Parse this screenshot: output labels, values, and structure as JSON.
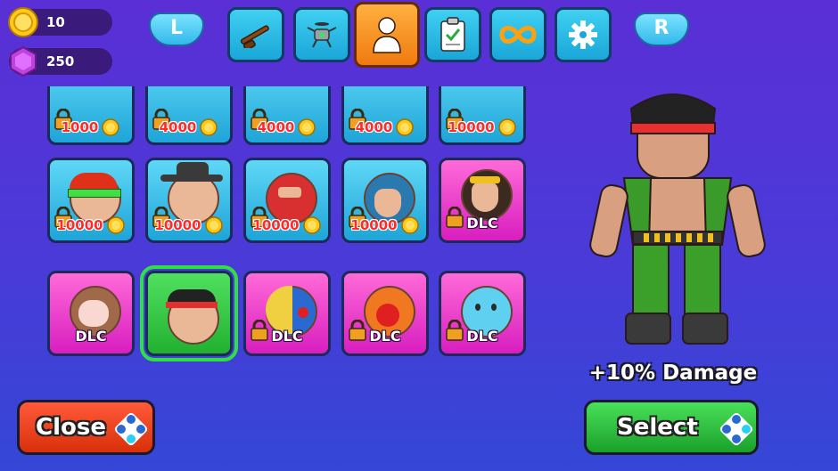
{
  "currency": {
    "coins": "10",
    "gems": "250"
  },
  "nav": {
    "left_shoulder": "L",
    "right_shoulder": "R",
    "tabs": [
      {
        "icon": "rifle-icon",
        "active": false
      },
      {
        "icon": "drone-icon",
        "active": false
      },
      {
        "icon": "person-icon",
        "active": true
      },
      {
        "icon": "clipboard-check-icon",
        "active": false
      },
      {
        "icon": "infinity-icon",
        "active": false
      },
      {
        "icon": "gear-icon",
        "active": false
      }
    ]
  },
  "grid": {
    "row_top": [
      {
        "price": "1000",
        "locked": true
      },
      {
        "price": "4000",
        "locked": true
      },
      {
        "price": "4000",
        "locked": true
      },
      {
        "price": "4000",
        "locked": true
      },
      {
        "price": "10000",
        "locked": true
      }
    ],
    "row_middle": [
      {
        "price": "10000",
        "locked": true,
        "style": "blue"
      },
      {
        "price": "10000",
        "locked": true,
        "style": "blue"
      },
      {
        "price": "10000",
        "locked": true,
        "style": "blue"
      },
      {
        "price": "10000",
        "locked": true,
        "style": "blue"
      },
      {
        "label": "DLC",
        "locked": true,
        "style": "pink"
      }
    ],
    "row_bottom": [
      {
        "label": "DLC",
        "locked": false,
        "style": "pink"
      },
      {
        "label": "",
        "locked": false,
        "style": "green",
        "selected": true
      },
      {
        "label": "DLC",
        "locked": true,
        "style": "pink"
      },
      {
        "label": "DLC",
        "locked": true,
        "style": "pink"
      },
      {
        "label": "DLC",
        "locked": true,
        "style": "pink"
      }
    ]
  },
  "preview": {
    "perk": "+10% Damage"
  },
  "buttons": {
    "close": "Close",
    "select": "Select"
  },
  "colors": {
    "close": "#e83a1a",
    "select": "#2cc040",
    "coin": "#ffc81a",
    "gem": "#c040e0"
  }
}
